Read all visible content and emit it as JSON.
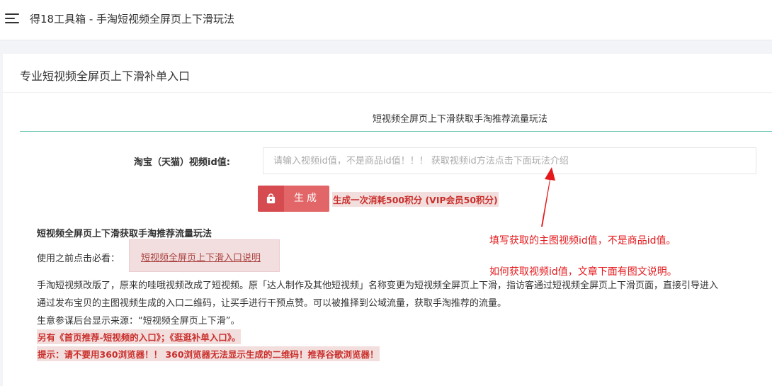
{
  "header": {
    "title": "得18工具箱 - 手淘短视频全屏页上下滑玩法",
    "menu_icon": "menu-icon"
  },
  "card": {
    "title": "专业短视频全屏页上下滑补单入口"
  },
  "tab": {
    "label": "短视频全屏页上下滑获取手淘推荐流量玩法",
    "accent_color": "#6cc4b6"
  },
  "form": {
    "field_label": "淘宝（天猫）视频id值:",
    "input_value": "",
    "input_placeholder": "请输入视频id值，不是商品id值！！！ 获取视频id方法点击下面玩法介绍",
    "generate_label": "生成",
    "generate_icon": "shopping-bag-icon",
    "button_color": "#e26567",
    "cost_note": "生成一次消耗500积分 (VIP会员50积分)"
  },
  "guide": {
    "title": "短视频全屏页上下滑获取手淘推荐流量玩法",
    "before_use": "使用之前点击必看：",
    "doc_link": "短视频全屏页上下滑入口说明",
    "desc_lines": [
      "手淘短视频改版了，原来的哇哦视频改成了短视频。原「达人制作及其他短视频」名称变更为短视频全屏页上下滑，指访客通过短视频全屏页上下滑页面，直接引导进入",
      "通过发布宝贝的主图视频生成的入口二维码，让买手进行干预点赞。可以被推择到公域流量，获取手淘推荐的流量。",
      "生意参谋后台显示来源：“短视频全屏页上下滑”。"
    ],
    "warnings": [
      "另有《首页推荐-短视频的入口》；《逛逛补单入口》。",
      "提示：请不要用360浏览器！！ 360浏览器无法显示生成的二维码！推荐谷歌浏览器！"
    ],
    "warning_color": "#c9302c"
  },
  "annotations": {
    "line1": "填写获取的主图视频id值，不是商品id值。",
    "line2": "如何获取视频id值，文章下面有图文说明。",
    "color": "#e5191c"
  }
}
